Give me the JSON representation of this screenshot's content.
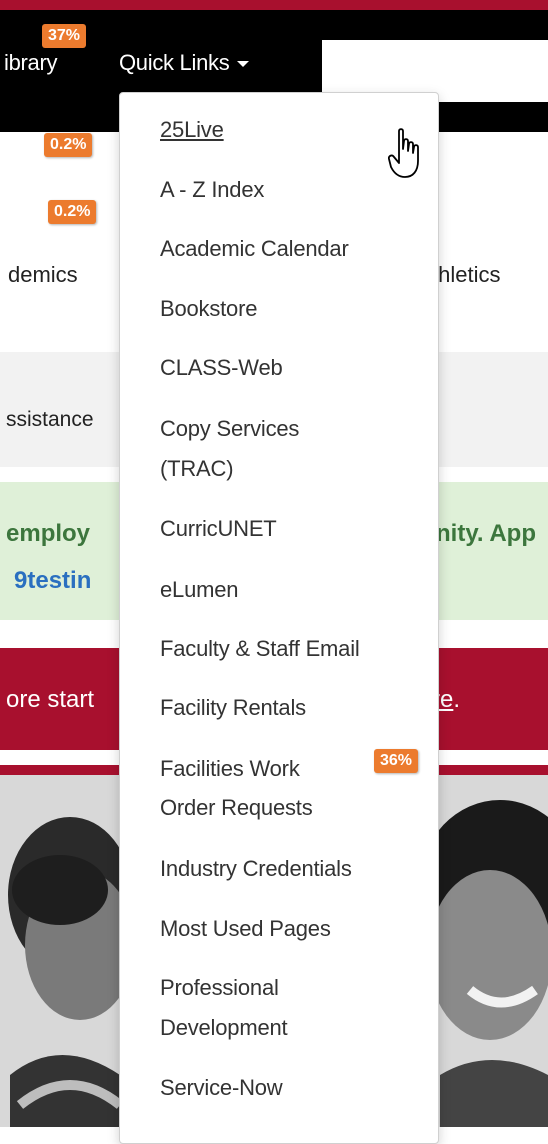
{
  "nav": {
    "library": "ibrary",
    "quick_links": "Quick Links"
  },
  "subnav": {
    "academics": "demics",
    "athletics": "thletics"
  },
  "grey": {
    "text": "ssistance"
  },
  "notice": {
    "line1_left": "employ",
    "line1_right": "nity. App",
    "link": "9testin"
  },
  "banner": {
    "left": "ore start",
    "right_underlined": "re",
    "right_end": "."
  },
  "dropdown": {
    "items": [
      {
        "label": "25Live"
      },
      {
        "label": "A - Z Index"
      },
      {
        "label": "Academic Calendar"
      },
      {
        "label": "Bookstore"
      },
      {
        "label": "CLASS-Web"
      },
      {
        "label": "Copy Services"
      },
      {
        "label": "(TRAC)"
      },
      {
        "label": "CurricUNET"
      },
      {
        "label": "eLumen"
      },
      {
        "label": "Faculty & Staff Email"
      },
      {
        "label": "Facility Rentals"
      },
      {
        "label": "Facilities Work"
      },
      {
        "label": "Order Requests"
      },
      {
        "label": "Industry Credentials"
      },
      {
        "label": "Most Used Pages"
      },
      {
        "label": "Professional"
      },
      {
        "label": "Development"
      },
      {
        "label": "Service-Now"
      }
    ]
  },
  "badges": {
    "quick_links": "37%",
    "item_25live": "0.2%",
    "item_az": "0.2%",
    "item_facilities": "36%"
  },
  "colors": {
    "maroon": "#a8102e",
    "badge": "#ec7b2e",
    "notice_green_bg": "#dff0d8",
    "notice_green_text": "#3c763d",
    "link_blue": "#2a6fc0"
  }
}
